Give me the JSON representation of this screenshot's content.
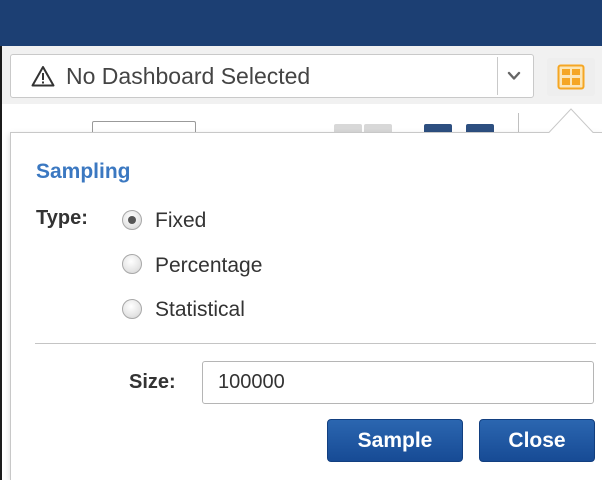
{
  "toolbar": {
    "dashboard_selector": {
      "value": "No Dashboard Selected",
      "icon": "warning-icon",
      "dropdown_icon": "chevron-down-icon"
    },
    "layout_button": {
      "icon": "dashboard-grid-icon",
      "color": "#f5a623"
    }
  },
  "sampling_popover": {
    "title": "Sampling",
    "type_label": "Type:",
    "options": [
      "Fixed",
      "Percentage",
      "Statistical"
    ],
    "selected_option": "Fixed",
    "size_label": "Size:",
    "size_value": "100000",
    "sample_button": "Sample",
    "close_button": "Close"
  },
  "colors": {
    "header_bar": "#1c3f73",
    "accent_title": "#3b78c1",
    "button_primary": "#1f5aa6"
  }
}
